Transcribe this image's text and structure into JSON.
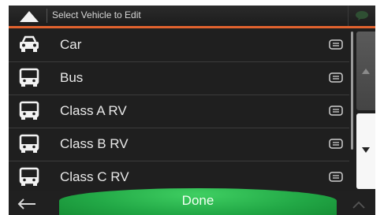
{
  "header": {
    "title": "Select Vehicle to Edit",
    "up_icon": "up-arrow-icon",
    "message_icon": "speech-bubble-icon"
  },
  "vehicles": [
    {
      "label": "Car",
      "icon": "car-icon"
    },
    {
      "label": "Bus",
      "icon": "bus-icon"
    },
    {
      "label": "Class A RV",
      "icon": "bus-icon"
    },
    {
      "label": "Class B RV",
      "icon": "bus-icon"
    },
    {
      "label": "Class C RV",
      "icon": "bus-icon"
    }
  ],
  "scroll": {
    "up_icon": "scroll-up-arrow-icon",
    "down_icon": "scroll-down-arrow-icon"
  },
  "footer": {
    "back_icon": "back-arrow-icon",
    "done_label": "Done",
    "expand_icon": "chevron-up-icon"
  },
  "colors": {
    "accent": "#e0622e",
    "done_green": "#22a846",
    "background": "#1f1f1f"
  }
}
